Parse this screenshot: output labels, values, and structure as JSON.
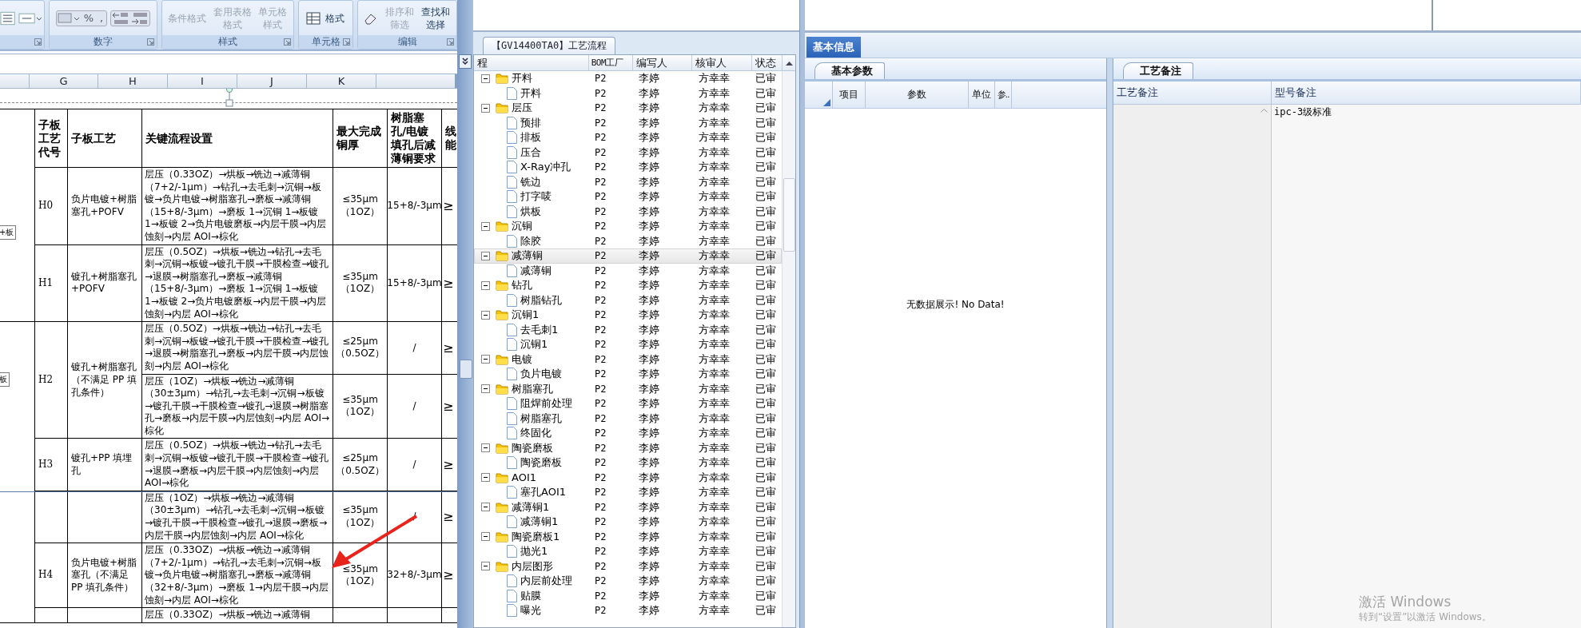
{
  "excel": {
    "ribbon_groups": [
      {
        "kind": "alignment"
      },
      {
        "kind": "number",
        "label": "数字",
        "buttons": [
          {
            "label": "%"
          },
          {
            "label": ","
          }
        ]
      },
      {
        "kind": "styles",
        "label": "样式",
        "buttons": [
          {
            "label": "条件格式",
            "disabled": true
          },
          {
            "label": "套用表格格式",
            "disabled": true
          },
          {
            "label": "单元格样式",
            "disabled": true
          }
        ]
      },
      {
        "kind": "cells",
        "label": "单元格",
        "buttons": [
          {
            "label": "格式",
            "disabled": false
          }
        ]
      },
      {
        "kind": "editing",
        "label": "编辑",
        "buttons": [
          {
            "label": "排序和筛选",
            "disabled": true
          },
          {
            "label": "查找和选择",
            "disabled": false
          }
        ]
      }
    ],
    "column_letters": [
      "G",
      "H",
      "I",
      "J",
      "K"
    ],
    "doc_table": {
      "headers": [
        "子板工艺代号",
        "子板工艺",
        "关键流程设置",
        "最大完成铜厚",
        "树脂塞孔/电镀填孔后减薄铜要求",
        "线能"
      ],
      "side_labels": [
        "+板",
        "板"
      ],
      "groups": [
        {
          "code": "H0",
          "process": "负片电镀+树脂塞孔+POFV",
          "steps": [
            {
              "flow": "层压（0.33OZ）→烘板→铣边→减薄铜（7+2/-1μm）→钻孔→去毛刺→沉铜→板镀→负片电镀→树脂塞孔→磨板→减薄铜（15+8/-3μm）→磨板 1→沉铜 1→板镀 1→板镀 2→负片电镀磨板→内层干膜→内层蚀刻→内层 AOI→棕化",
              "copper": "≤35μm（1OZ）",
              "thinning": "15+8/-3μm",
              "capability": "≥"
            }
          ]
        },
        {
          "code": "H1",
          "process": "镀孔+树脂塞孔+POFV",
          "steps": [
            {
              "flow": "层压（0.5OZ）→烘板→铣边→钻孔→去毛刺→沉铜→板镀→镀孔干膜→干膜检查→镀孔→退膜→树脂塞孔→磨板→减薄铜（15+8/-3μm）→磨板 1→沉铜 1→板镀 1→板镀 2→负片电镀磨板→内层干膜→内层蚀刻→内层 AOI→棕化",
              "copper": "≤35μm（1OZ）",
              "thinning": "15+8/-3μm",
              "capability": "≥"
            }
          ]
        },
        {
          "code": "H2",
          "process": "镀孔+树脂塞孔（不满足 PP 填孔条件）",
          "steps": [
            {
              "flow": "层压（0.5OZ）→烘板→铣边→钻孔→去毛刺→沉铜→板镀→镀孔干膜→干膜检查→镀孔→退膜→树脂塞孔→磨板→内层干膜→内层蚀刻→内层 AOI→棕化",
              "copper": "≤25μm（0.5OZ）",
              "thinning": "/",
              "capability": "≥"
            },
            {
              "flow": "层压（1OZ）→烘板→铣边→减薄铜（30±3μm）→钻孔→去毛刺→沉铜→板镀→镀孔干膜→干膜检查→镀孔→退膜→树脂塞孔→磨板→内层干膜→内层蚀刻→内层 AOI→棕化",
              "copper": "≤35μm（1OZ）",
              "thinning": "/",
              "capability": "≥"
            }
          ]
        },
        {
          "code": "H3",
          "process": "镀孔+PP 填埋孔",
          "steps": [
            {
              "flow": "层压（0.5OZ）→烘板→铣边→钻孔→去毛刺→沉铜→板镀→镀孔干膜→干膜检查→镀孔→退膜→磨板→内层干膜→内层蚀刻→内层 AOI→棕化",
              "copper": "≤25μm（0.5OZ）",
              "thinning": "/",
              "capability": "≥"
            }
          ]
        },
        {
          "steps": [
            {
              "flow": "层压（1OZ）→烘板→铣边→减薄铜（30±3μm）→钻孔→去毛刺→沉铜→板镀→镀孔干膜→干膜检查→镀孔→退膜→磨板→内层干膜→内层蚀刻→内层 AOI→棕化",
              "copper": "≤35μm（1OZ）",
              "thinning": "/",
              "capability": "≥"
            }
          ]
        },
        {
          "code": "H4",
          "process": "负片电镀+树脂塞孔（不满足PP 填孔条件）",
          "steps": [
            {
              "flow": "层压（0.33OZ）→烘板→铣边→减薄铜（7+2/-1μm）→钻孔→去毛刺→沉铜→板镀→负片电镀→树脂塞孔→磨板→减薄铜（32+8/-3μm）→磨板 1→内层干膜→内层蚀刻→内层 AOI→棕化",
              "copper": "≤35μm（1OZ）",
              "thinning": "32+8/-3μm",
              "capability": "≥"
            }
          ]
        },
        {
          "steps": [
            {
              "flow": "层压（0.33OZ）→烘板→铣边→减薄铜"
            }
          ]
        }
      ]
    }
  },
  "tree": {
    "tab": "【GV14400TA0】工艺流程",
    "columns": [
      "程",
      "BOM工厂",
      "编写人",
      "核审人",
      "状态"
    ],
    "nodes": [
      {
        "label": "开料",
        "bom": "P2",
        "writer": "李婷",
        "reviewer": "方幸幸",
        "status": "已审",
        "selected": false,
        "expanded": true,
        "children": [
          {
            "label": "开料",
            "bom": "P2",
            "writer": "李婷",
            "reviewer": "方幸幸",
            "status": "已审",
            "selected": false
          }
        ]
      },
      {
        "label": "层压",
        "bom": "P2",
        "writer": "李婷",
        "reviewer": "方幸幸",
        "status": "已审",
        "selected": false,
        "expanded": true,
        "children": [
          {
            "label": "预排",
            "bom": "P2",
            "writer": "李婷",
            "reviewer": "方幸幸",
            "status": "已审",
            "selected": false
          },
          {
            "label": "排板",
            "bom": "P2",
            "writer": "李婷",
            "reviewer": "方幸幸",
            "status": "已审",
            "selected": false
          },
          {
            "label": "压合",
            "bom": "P2",
            "writer": "李婷",
            "reviewer": "方幸幸",
            "status": "已审",
            "selected": false
          },
          {
            "label": "X-Ray冲孔",
            "bom": "P2",
            "writer": "李婷",
            "reviewer": "方幸幸",
            "status": "已审",
            "selected": false
          },
          {
            "label": "铣边",
            "bom": "P2",
            "writer": "李婷",
            "reviewer": "方幸幸",
            "status": "已审",
            "selected": false
          },
          {
            "label": "打字唛",
            "bom": "P2",
            "writer": "李婷",
            "reviewer": "方幸幸",
            "status": "已审",
            "selected": false
          },
          {
            "label": "烘板",
            "bom": "P2",
            "writer": "李婷",
            "reviewer": "方幸幸",
            "status": "已审",
            "selected": false
          }
        ]
      },
      {
        "label": "沉铜",
        "bom": "P2",
        "writer": "李婷",
        "reviewer": "方幸幸",
        "status": "已审",
        "selected": false,
        "expanded": true,
        "children": [
          {
            "label": "除胶",
            "bom": "P2",
            "writer": "李婷",
            "reviewer": "方幸幸",
            "status": "已审",
            "selected": false
          }
        ]
      },
      {
        "label": "减薄铜",
        "bom": "P2",
        "writer": "李婷",
        "reviewer": "方幸幸",
        "status": "已审",
        "selected": true,
        "expanded": true,
        "children": [
          {
            "label": "减薄铜",
            "bom": "P2",
            "writer": "李婷",
            "reviewer": "方幸幸",
            "status": "已审",
            "selected": false
          }
        ]
      },
      {
        "label": "钻孔",
        "bom": "P2",
        "writer": "李婷",
        "reviewer": "方幸幸",
        "status": "已审",
        "selected": false,
        "expanded": true,
        "children": [
          {
            "label": "树脂钻孔",
            "bom": "P2",
            "writer": "李婷",
            "reviewer": "方幸幸",
            "status": "已审",
            "selected": false
          }
        ]
      },
      {
        "label": "沉铜1",
        "bom": "P2",
        "writer": "李婷",
        "reviewer": "方幸幸",
        "status": "已审",
        "selected": false,
        "expanded": true,
        "children": [
          {
            "label": "去毛刺1",
            "bom": "P2",
            "writer": "李婷",
            "reviewer": "方幸幸",
            "status": "已审",
            "selected": false
          },
          {
            "label": "沉铜1",
            "bom": "P2",
            "writer": "李婷",
            "reviewer": "方幸幸",
            "status": "已审",
            "selected": false
          }
        ]
      },
      {
        "label": "电镀",
        "bom": "P2",
        "writer": "李婷",
        "reviewer": "方幸幸",
        "status": "已审",
        "selected": false,
        "expanded": true,
        "children": [
          {
            "label": "负片电镀",
            "bom": "P2",
            "writer": "李婷",
            "reviewer": "方幸幸",
            "status": "已审",
            "selected": false
          }
        ]
      },
      {
        "label": "树脂塞孔",
        "bom": "P2",
        "writer": "李婷",
        "reviewer": "方幸幸",
        "status": "已审",
        "selected": false,
        "expanded": true,
        "children": [
          {
            "label": "阻焊前处理",
            "bom": "P2",
            "writer": "李婷",
            "reviewer": "方幸幸",
            "status": "已审",
            "selected": false
          },
          {
            "label": "树脂塞孔",
            "bom": "P2",
            "writer": "李婷",
            "reviewer": "方幸幸",
            "status": "已审",
            "selected": false
          },
          {
            "label": "终固化",
            "bom": "P2",
            "writer": "李婷",
            "reviewer": "方幸幸",
            "status": "已审",
            "selected": false
          }
        ]
      },
      {
        "label": "陶瓷磨板",
        "bom": "P2",
        "writer": "李婷",
        "reviewer": "方幸幸",
        "status": "已审",
        "selected": false,
        "expanded": true,
        "children": [
          {
            "label": "陶瓷磨板",
            "bom": "P2",
            "writer": "李婷",
            "reviewer": "方幸幸",
            "status": "已审",
            "selected": false
          }
        ]
      },
      {
        "label": "AOI1",
        "bom": "P2",
        "writer": "李婷",
        "reviewer": "方幸幸",
        "status": "已审",
        "selected": false,
        "expanded": true,
        "children": [
          {
            "label": "塞孔AOI1",
            "bom": "P2",
            "writer": "李婷",
            "reviewer": "方幸幸",
            "status": "已审",
            "selected": false
          }
        ]
      },
      {
        "label": "减薄铜1",
        "bom": "P2",
        "writer": "李婷",
        "reviewer": "方幸幸",
        "status": "已审",
        "selected": false,
        "expanded": true,
        "children": [
          {
            "label": "减薄铜1",
            "bom": "P2",
            "writer": "李婷",
            "reviewer": "方幸幸",
            "status": "已审",
            "selected": false
          }
        ]
      },
      {
        "label": "陶瓷磨板1",
        "bom": "P2",
        "writer": "李婷",
        "reviewer": "方幸幸",
        "status": "已审",
        "selected": false,
        "expanded": true,
        "children": [
          {
            "label": "抛光1",
            "bom": "P2",
            "writer": "李婷",
            "reviewer": "方幸幸",
            "status": "已审",
            "selected": false
          }
        ]
      },
      {
        "label": "内层图形",
        "bom": "P2",
        "writer": "李婷",
        "reviewer": "方幸幸",
        "status": "已审",
        "selected": false,
        "expanded": true,
        "children": [
          {
            "label": "内层前处理",
            "bom": "P2",
            "writer": "李婷",
            "reviewer": "方幸幸",
            "status": "已审",
            "selected": false
          },
          {
            "label": "贴膜",
            "bom": "P2",
            "writer": "李婷",
            "reviewer": "方幸幸",
            "status": "已审",
            "selected": false
          },
          {
            "label": "曝光",
            "bom": "P2",
            "writer": "李婷",
            "reviewer": "方幸幸",
            "status": "已审",
            "selected": false
          }
        ]
      }
    ]
  },
  "info": {
    "title": "基本信息",
    "params": {
      "tab": "基本参数",
      "columns": [
        "项目",
        "参数",
        "单位",
        "参.."
      ],
      "empty_message": "无数据展示! No Data!"
    },
    "notes": {
      "tab": "工艺备注",
      "columns": [
        "工艺备注",
        "型号备注"
      ],
      "rows": [
        {
          "model_note": "ipc-3级标准"
        }
      ]
    }
  },
  "os_notice": {
    "title": "激活 Windows",
    "text": "转到“设置”以激活 Windows。"
  }
}
